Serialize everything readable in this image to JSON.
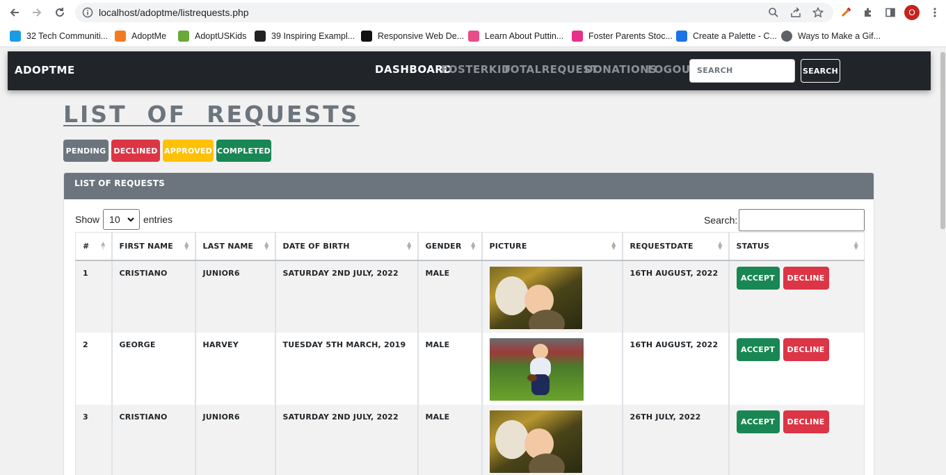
{
  "browser": {
    "url": "localhost/adoptme/listrequests.php",
    "avatar_letter": "O",
    "bookmarks": [
      {
        "label": "32 Tech Communiti...",
        "color": "#1a9be6"
      },
      {
        "label": "AdoptMe",
        "color": "#f47a20"
      },
      {
        "label": "AdoptUSKids",
        "color": "#6aa83a"
      },
      {
        "label": "39 Inspiring Exampl...",
        "color": "#222222"
      },
      {
        "label": "Responsive Web De...",
        "color": "#111111"
      },
      {
        "label": "Learn About Puttin...",
        "color": "#e84d8a"
      },
      {
        "label": "Foster Parents Stoc...",
        "color": "#e8308a"
      },
      {
        "label": "Create a Palette - C...",
        "color": "#1a73e8"
      },
      {
        "label": "Ways to Make a Gif...",
        "color": "#5f6368"
      }
    ]
  },
  "app": {
    "brand": "ADOPTME",
    "nav": [
      {
        "label": "DASHBOARD",
        "active": true
      },
      {
        "label": "FOSTERKID",
        "active": false
      },
      {
        "label": "TOTALREQUEST",
        "active": false
      },
      {
        "label": "DONATIONS",
        "active": false
      },
      {
        "label": "LOGOUT",
        "active": false
      }
    ],
    "search_placeholder": "SEARCH",
    "search_button": "SEARCH"
  },
  "heading": "LIST  OF  REQUESTS",
  "filters": [
    {
      "label": "PENDING",
      "color": "#6c757d"
    },
    {
      "label": "DECLINED",
      "color": "#dc3545"
    },
    {
      "label": "APPROVED",
      "color": "#ffc107"
    },
    {
      "label": "COMPLETED",
      "color": "#198754"
    }
  ],
  "card": {
    "title": "LIST OF REQUESTS",
    "show_label": "Show",
    "entries_value": "10",
    "entries_label": "entries",
    "search_label": "Search:"
  },
  "table": {
    "columns": [
      "#",
      "FIRST NAME",
      "LAST NAME",
      "DATE OF BIRTH",
      "GENDER",
      "PICTURE",
      "REQUESTDATE",
      "STATUS"
    ],
    "rows": [
      {
        "id": "1",
        "first": "CRISTIANO",
        "last": "JUNIOR6",
        "dob": "SATURDAY 2ND JULY, 2022",
        "gender": "MALE",
        "picture": "child-with-mother-photo",
        "request_date": "16TH AUGUST, 2022",
        "accept": "ACCEPT",
        "decline": "DECLINE"
      },
      {
        "id": "2",
        "first": "GEORGE",
        "last": "HARVEY",
        "dob": "TUESDAY 5TH MARCH, 2019",
        "gender": "MALE",
        "picture": "toddler-with-football-photo",
        "request_date": "16TH AUGUST, 2022",
        "accept": "ACCEPT",
        "decline": "DECLINE"
      },
      {
        "id": "3",
        "first": "CRISTIANO",
        "last": "JUNIOR6",
        "dob": "SATURDAY 2ND JULY, 2022",
        "gender": "MALE",
        "picture": "child-with-mother-photo",
        "request_date": "26TH JULY, 2022",
        "accept": "ACCEPT",
        "decline": "DECLINE"
      }
    ]
  }
}
